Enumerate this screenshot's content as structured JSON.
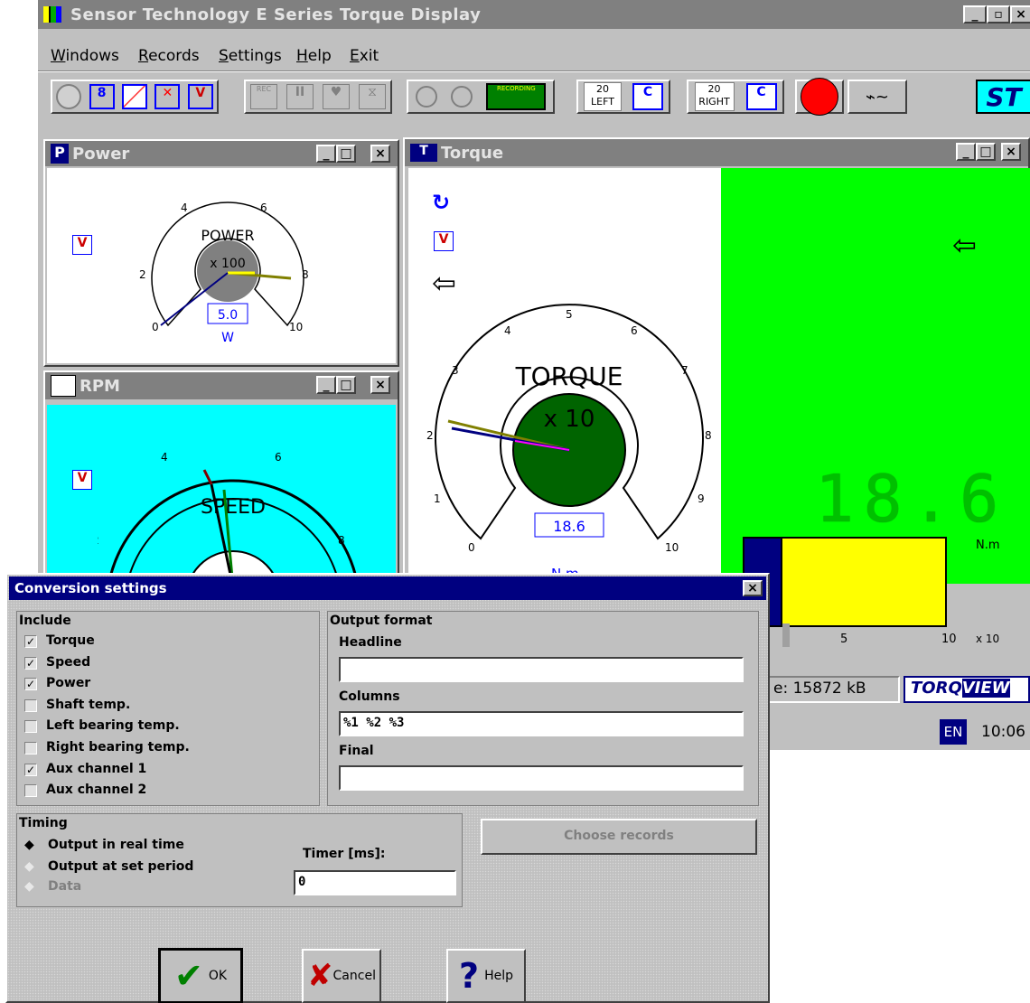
{
  "app": {
    "title": "Sensor Technology E Series Torque Display",
    "win_controls": [
      "_",
      "▫",
      "×"
    ]
  },
  "menu": [
    "Windows",
    "Records",
    "Settings",
    "Help",
    "Exit"
  ],
  "toolbar": {
    "left_spin": {
      "value": "20",
      "label": "LEFT"
    },
    "right_spin": {
      "value": "20",
      "label": "RIGHT"
    },
    "rec_label": "REC",
    "rec_banner": "RECORDING",
    "logo": "ST"
  },
  "power": {
    "title": "Power",
    "gauge_label": "POWER",
    "multiplier": "x 100",
    "ticks": [
      "0",
      "2",
      "4",
      "6",
      "8",
      "10"
    ],
    "readout": "5.0",
    "unit": "W",
    "value": 5.0
  },
  "rpm": {
    "title": "RPM",
    "gauge_label": "SPEED",
    "ticks": [
      "2",
      "4",
      "6",
      "8"
    ]
  },
  "torque": {
    "title": "Torque",
    "gauge_label": "TORQUE",
    "multiplier": "x 10",
    "ticks": [
      "0",
      "1",
      "2",
      "3",
      "4",
      "5",
      "6",
      "7",
      "8",
      "9",
      "10"
    ],
    "readout": "18.6",
    "unit": "N.m",
    "digital": "18.6",
    "digital_unit": "N.m",
    "bar_ticks": [
      "5",
      "10",
      "x 10"
    ],
    "bar_fraction": 0.186
  },
  "status": {
    "file_size": "e: 15872 kB",
    "brand_a": "TORQ",
    "brand_b": "VIEW",
    "lang": "EN",
    "time": "10:06"
  },
  "dialog": {
    "title": "Conversion settings",
    "include_header": "Include",
    "include": [
      {
        "label": "Torque",
        "checked": true
      },
      {
        "label": "Speed",
        "checked": true
      },
      {
        "label": "Power",
        "checked": true
      },
      {
        "label": "Shaft temp.",
        "checked": false
      },
      {
        "label": "Left bearing temp.",
        "checked": false
      },
      {
        "label": "Right bearing temp.",
        "checked": false
      },
      {
        "label": "Aux channel 1",
        "checked": true
      },
      {
        "label": "Aux channel 2",
        "checked": false
      }
    ],
    "output_header": "Output format",
    "headline_label": "Headline",
    "headline_value": "",
    "columns_label": "Columns",
    "columns_value": "%1 %2 %3",
    "final_label": "Final",
    "final_value": "",
    "timing_header": "Timing",
    "timing": [
      "Output in real time",
      "Output at set period",
      "Data"
    ],
    "timer_label": "Timer [ms]:",
    "timer_value": "0",
    "choose_records": "Choose records",
    "ok": "OK",
    "cancel": "Cancel",
    "help": "Help",
    "colors": {
      "title_bg": "#000080",
      "face": "#c0c0c0"
    }
  },
  "colors": {
    "green_panel": "#00ff00",
    "cyan_panel": "#00ffff",
    "dial_green": "#006400",
    "bar_yellow": "#ffff00",
    "record_red": "#ff0000"
  }
}
